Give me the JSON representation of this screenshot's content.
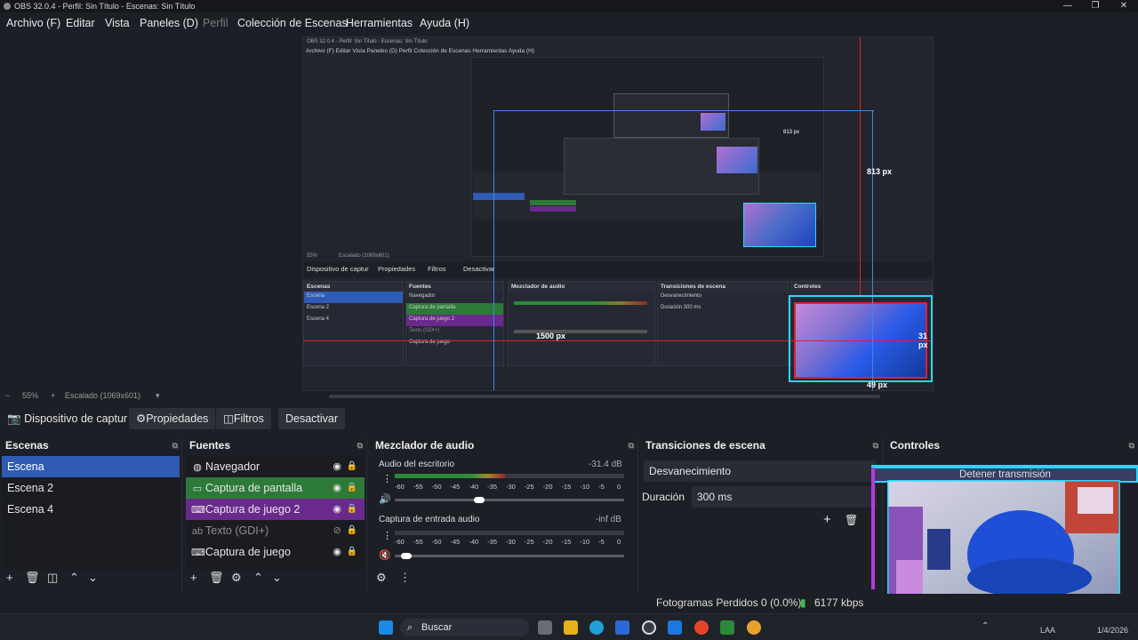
{
  "window": {
    "title": "OBS 32.0.4 - Perfil: Sin Título - Escenas: Sin Título",
    "minimize_icon": "minimize-icon",
    "maximize_icon": "restore-icon",
    "close_icon": "close-icon"
  },
  "menu": {
    "items": [
      "Archivo (F)",
      "Editar",
      "Vista",
      "Paneles (D)",
      "Perfil",
      "Colección de Escenas",
      "Herramientas",
      "Ayuda (H)"
    ],
    "disabled_item": "Perfil"
  },
  "preview": {
    "inner_title": "OBS 32.0.4 - Perfil: Sin Título - Escenas: Sin Título",
    "inner_menu": "Archivo (F)    Editar    Vista    Paneles (D)    Perfil    Colección de Escenas    Herramientas    Ayuda (H)",
    "inner_sourcebar": [
      "Dispositivo de captur",
      "Propiedades",
      "Filtros",
      "Desactivar"
    ],
    "inner_zoom": "55%",
    "inner_scale": "Escalado (1069x601)",
    "measure_right": "813 px",
    "measure_left": "1500 px",
    "measure_side": "31 px",
    "measure_bottom": "49 px",
    "measure_small": "813 px"
  },
  "zoom": {
    "minus": "−",
    "value": "55%",
    "plus": "+",
    "scale_label": "Escalado (1069x601)",
    "dropdown_icon": "chevron-down-icon"
  },
  "sourcebar": {
    "source_name": "Dispositivo de captur",
    "properties": "Propiedades",
    "filters": "Filtros",
    "deactivate": "Desactivar"
  },
  "scenes": {
    "title": "Escenas",
    "items": [
      "Escena",
      "Escena 2",
      "Escena 4"
    ],
    "selected": "Escena"
  },
  "sources": {
    "title": "Fuentes",
    "items": [
      {
        "label": "Navegador",
        "icon": "globe-icon",
        "visible": true,
        "style": "normal"
      },
      {
        "label": "Captura de pantalla",
        "icon": "monitor-icon",
        "visible": true,
        "style": "green"
      },
      {
        "label": "Captura de juego 2",
        "icon": "gamepad-icon",
        "visible": true,
        "style": "purple"
      },
      {
        "label": "Texto (GDI+)",
        "icon": "text-icon",
        "visible": false,
        "style": "dim"
      },
      {
        "label": "Captura de juego",
        "icon": "gamepad-icon",
        "visible": true,
        "style": "normal"
      }
    ]
  },
  "mixer": {
    "title": "Mezclador de audio",
    "channels": [
      {
        "name": "Audio del escritorio",
        "db": "-31.4 dB",
        "level": 0.48,
        "volume": 0.36,
        "muted": false
      },
      {
        "name": "Captura de entrada audio",
        "db": "-inf dB",
        "level": 0.0,
        "volume": 0.03,
        "muted": true
      }
    ],
    "scale": [
      "-60",
      "-55",
      "-50",
      "-45",
      "-40",
      "-35",
      "-30",
      "-25",
      "-20",
      "-15",
      "-10",
      "-5",
      "0"
    ]
  },
  "transitions": {
    "title": "Transiciones de escena",
    "current": "Desvanecimiento",
    "duration_label": "Duración",
    "duration_value": "300 ms"
  },
  "controls": {
    "title": "Controles",
    "stop_stream": "Detener transmisión"
  },
  "status": {
    "dropped": "Fotogramas Perdidos 0 (0.0%)",
    "kbps": "6177 kbps"
  },
  "taskbar": {
    "search": "Buscar",
    "lang": "LAA",
    "date": "1/4/2026"
  },
  "colors": {
    "accent_blue": "#2f5bb4",
    "source_green": "#2d7a38",
    "source_purple": "#6a2a8c",
    "guide_red": "#e02030",
    "guide_blue": "#3a88e8",
    "frame_cyan": "#29d6ff"
  }
}
